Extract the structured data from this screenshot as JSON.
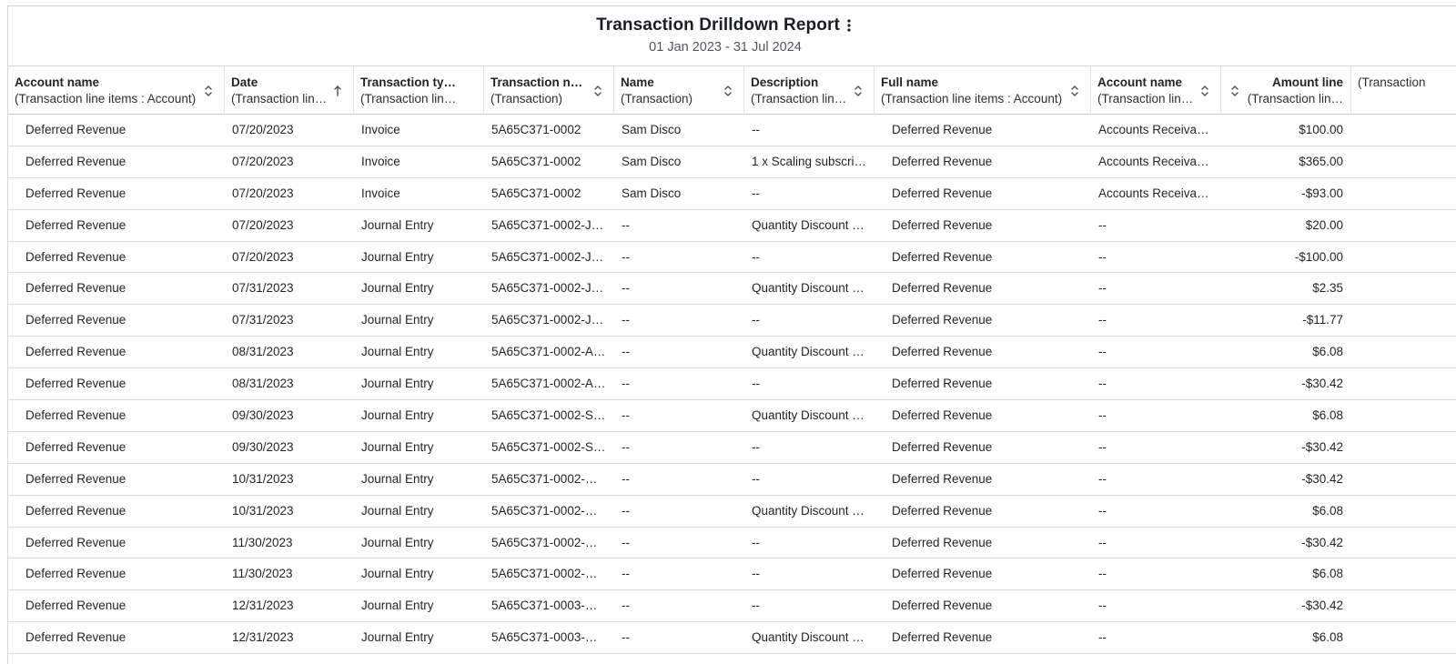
{
  "report": {
    "title": "Transaction Drilldown Report",
    "subtitle": "01 Jan 2023 - 31 Jul 2024",
    "menu_icon": "kebab-menu-icon"
  },
  "columns": [
    {
      "title": "Account name",
      "sub": "(Transaction line items : Account)",
      "sort": "unsorted"
    },
    {
      "title": "Date",
      "sub": "(Transaction lin…",
      "sort": "ascending"
    },
    {
      "title": "Transaction type",
      "sub": "(Transaction line it…",
      "sort": "none"
    },
    {
      "title": "Transaction nu…",
      "sub": "(Transaction)",
      "sort": "unsorted"
    },
    {
      "title": "Name",
      "sub": "(Transaction)",
      "sort": "unsorted"
    },
    {
      "title": "Description",
      "sub": "(Transaction lin…",
      "sort": "unsorted"
    },
    {
      "title": "Full name",
      "sub": "(Transaction line items : Account)",
      "sort": "unsorted"
    },
    {
      "title": "Account name",
      "sub": "(Transaction lin…",
      "sort": "unsorted"
    },
    {
      "title": "Amount line",
      "sub": "(Transaction lin…",
      "sort": "unsorted"
    },
    {
      "title": "",
      "sub": "(Transaction",
      "sort": "none"
    }
  ],
  "rows": [
    [
      "Deferred Revenue",
      "07/20/2023",
      "Invoice",
      "5A65C371-0002",
      "Sam Disco",
      "--",
      "Deferred Revenue",
      "Accounts Receiva…",
      "$100.00"
    ],
    [
      "Deferred Revenue",
      "07/20/2023",
      "Invoice",
      "5A65C371-0002",
      "Sam Disco",
      "1 x Scaling subscri…",
      "Deferred Revenue",
      "Accounts Receiva…",
      "$365.00"
    ],
    [
      "Deferred Revenue",
      "07/20/2023",
      "Invoice",
      "5A65C371-0002",
      "Sam Disco",
      "--",
      "Deferred Revenue",
      "Accounts Receiva…",
      "-$93.00"
    ],
    [
      "Deferred Revenue",
      "07/20/2023",
      "Journal Entry",
      "5A65C371-0002-J…",
      "--",
      "Quantity Discount …",
      "Deferred Revenue",
      "--",
      "$20.00"
    ],
    [
      "Deferred Revenue",
      "07/20/2023",
      "Journal Entry",
      "5A65C371-0002-J…",
      "--",
      "--",
      "Deferred Revenue",
      "--",
      "-$100.00"
    ],
    [
      "Deferred Revenue",
      "07/31/2023",
      "Journal Entry",
      "5A65C371-0002-J…",
      "--",
      "Quantity Discount …",
      "Deferred Revenue",
      "--",
      "$2.35"
    ],
    [
      "Deferred Revenue",
      "07/31/2023",
      "Journal Entry",
      "5A65C371-0002-J…",
      "--",
      "--",
      "Deferred Revenue",
      "--",
      "-$11.77"
    ],
    [
      "Deferred Revenue",
      "08/31/2023",
      "Journal Entry",
      "5A65C371-0002-A…",
      "--",
      "Quantity Discount …",
      "Deferred Revenue",
      "--",
      "$6.08"
    ],
    [
      "Deferred Revenue",
      "08/31/2023",
      "Journal Entry",
      "5A65C371-0002-A…",
      "--",
      "--",
      "Deferred Revenue",
      "--",
      "-$30.42"
    ],
    [
      "Deferred Revenue",
      "09/30/2023",
      "Journal Entry",
      "5A65C371-0002-S…",
      "--",
      "Quantity Discount …",
      "Deferred Revenue",
      "--",
      "$6.08"
    ],
    [
      "Deferred Revenue",
      "09/30/2023",
      "Journal Entry",
      "5A65C371-0002-S…",
      "--",
      "--",
      "Deferred Revenue",
      "--",
      "-$30.42"
    ],
    [
      "Deferred Revenue",
      "10/31/2023",
      "Journal Entry",
      "5A65C371-0002-…",
      "--",
      "--",
      "Deferred Revenue",
      "--",
      "-$30.42"
    ],
    [
      "Deferred Revenue",
      "10/31/2023",
      "Journal Entry",
      "5A65C371-0002-…",
      "--",
      "Quantity Discount …",
      "Deferred Revenue",
      "--",
      "$6.08"
    ],
    [
      "Deferred Revenue",
      "11/30/2023",
      "Journal Entry",
      "5A65C371-0002-…",
      "--",
      "--",
      "Deferred Revenue",
      "--",
      "-$30.42"
    ],
    [
      "Deferred Revenue",
      "11/30/2023",
      "Journal Entry",
      "5A65C371-0002-…",
      "--",
      "--",
      "Deferred Revenue",
      "--",
      "$6.08"
    ],
    [
      "Deferred Revenue",
      "12/31/2023",
      "Journal Entry",
      "5A65C371-0003-…",
      "--",
      "--",
      "Deferred Revenue",
      "--",
      "-$30.42"
    ],
    [
      "Deferred Revenue",
      "12/31/2023",
      "Journal Entry",
      "5A65C371-0003-…",
      "--",
      "Quantity Discount …",
      "Deferred Revenue",
      "--",
      "$6.08"
    ]
  ]
}
